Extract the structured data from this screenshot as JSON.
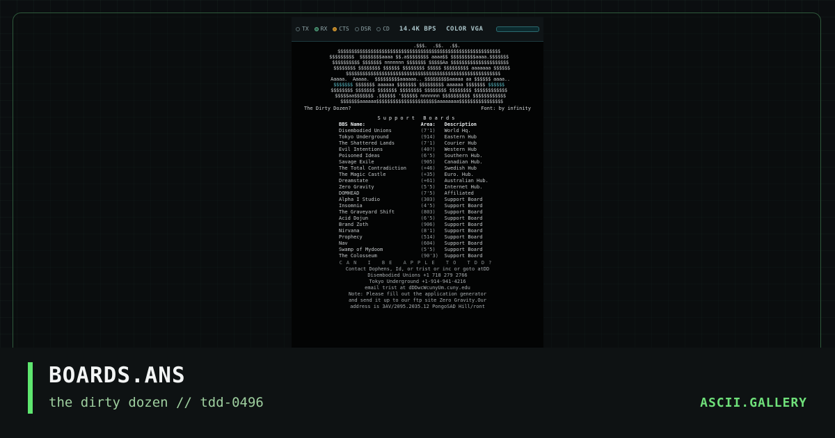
{
  "status_bar": {
    "indicators": [
      {
        "label": "TX",
        "state": "off"
      },
      {
        "label": "RX",
        "state": "on"
      },
      {
        "label": "CTS",
        "state": "amber"
      },
      {
        "label": "DSR",
        "state": "off"
      },
      {
        "label": "CD",
        "state": "off"
      }
    ],
    "speed": "14.4K BPS",
    "color_mode": "COLOR VGA"
  },
  "ansi": {
    "caption_left": "The Dirty Dozen?",
    "caption_right": "Font: by infinity",
    "section_title": "Support Boards",
    "columns": [
      "BBS Name:",
      "Area:",
      "Description"
    ],
    "boards": [
      {
        "name": "Disembodied Unions",
        "code": "(7'1)",
        "desc": "World Hq."
      },
      {
        "name": "Tokyo Underground",
        "code": "(914)",
        "desc": "Eastern Hub"
      },
      {
        "name": "The Shattered Lands",
        "code": "(7'1)",
        "desc": "Courier Hub"
      },
      {
        "name": "Evil Intentions",
        "code": "(40?)",
        "desc": "Western Hub"
      },
      {
        "name": "Poisoned Ideas",
        "code": "(6'5)",
        "desc": "Southern Hub."
      },
      {
        "name": "Savage Exile",
        "code": "(905)",
        "desc": "Canadian Hub."
      },
      {
        "name": "The Total Contradiction",
        "code": "(+46)",
        "desc": "Swedish Hub"
      },
      {
        "name": "The Magic Castle",
        "code": "(+35)",
        "desc": "Euro. Hub."
      },
      {
        "name": "Dreamstate",
        "code": "(+61)",
        "desc": "Australian Hub."
      },
      {
        "name": "Zero Gravity",
        "code": "(5'5)",
        "desc": "Internet Hub."
      },
      {
        "name": "DOMHEAD",
        "code": "(7'5)",
        "desc": "Affiliated"
      },
      {
        "name": "Alpha I Studio",
        "code": "(303)",
        "desc": "Support Board"
      },
      {
        "name": "Insomnia",
        "code": "(4'5)",
        "desc": "Support Board"
      },
      {
        "name": "The Graveyard Shift",
        "code": "(803)",
        "desc": "Support Board"
      },
      {
        "name": "Acid Dojun",
        "code": "(6'5)",
        "desc": "Support Board"
      },
      {
        "name": "Brand Zoth",
        "code": "(906)",
        "desc": "Support Board"
      },
      {
        "name": "Nirvana",
        "code": "(8'1)",
        "desc": "Support Board"
      },
      {
        "name": "Prophecy",
        "code": "(514)",
        "desc": "Support Board"
      },
      {
        "name": "Nav",
        "code": "(604)",
        "desc": "Support Board"
      },
      {
        "name": "Swamp of Mydoom",
        "code": "(5'5)",
        "desc": "Support Board"
      },
      {
        "name": "The Colosseum",
        "code": "(90'3)",
        "desc": "Support Board"
      }
    ],
    "apply_text": "CAN I BE APPLE TO TDD?",
    "contact_lines": [
      "Contact Dophens, Id, or trist or inc or goto atDD",
      "Disembodied Unions +1 718 279 2766",
      "Tokyo Underground +1-914-941-4216",
      "email trist at dDDwcWcunyUm.cuny.edu",
      "Note: Please fill out the application generator",
      "and send it up to our ftp site Zero Gravity.Our",
      "address is 3AV/2095.2035.12 PongoSAD Hill/ront"
    ]
  },
  "footer": {
    "title": "BOARDS.ANS",
    "subtitle": "the dirty dozen // tdd-0496",
    "brand": "ASCII.GALLERY"
  },
  "colors": {
    "accent": "#5ee66f",
    "frame_border": "#2f5a3c",
    "terminal_bg": "#030404"
  }
}
